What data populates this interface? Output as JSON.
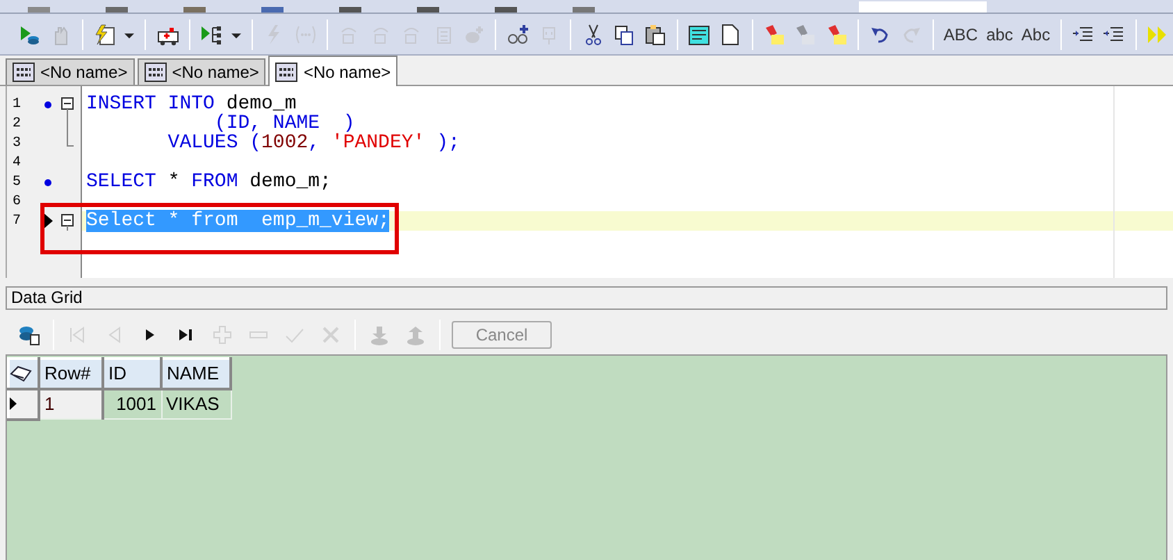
{
  "toolbar": {
    "items": [
      {
        "kind": "run",
        "disabled": false
      },
      {
        "kind": "hand",
        "disabled": true
      },
      {
        "kind": "sep"
      },
      {
        "kind": "script",
        "disabled": false
      },
      {
        "kind": "caret",
        "disabled": false
      },
      {
        "kind": "sep"
      },
      {
        "kind": "ambulance",
        "disabled": false
      },
      {
        "kind": "sep"
      },
      {
        "kind": "tree",
        "disabled": false
      },
      {
        "kind": "caret",
        "disabled": false
      },
      {
        "kind": "sep"
      },
      {
        "kind": "bolt",
        "disabled": true
      },
      {
        "kind": "dots",
        "disabled": true
      },
      {
        "kind": "sep"
      },
      {
        "kind": "step",
        "disabled": true
      },
      {
        "kind": "step",
        "disabled": true
      },
      {
        "kind": "step",
        "disabled": true
      },
      {
        "kind": "doc",
        "disabled": true
      },
      {
        "kind": "disc",
        "disabled": true
      },
      {
        "kind": "sep"
      },
      {
        "kind": "glasses",
        "disabled": false
      },
      {
        "kind": "plug",
        "disabled": true
      },
      {
        "kind": "sep"
      },
      {
        "kind": "cut",
        "disabled": false
      },
      {
        "kind": "copy",
        "disabled": false
      },
      {
        "kind": "paste",
        "disabled": false
      },
      {
        "kind": "sep"
      },
      {
        "kind": "note",
        "disabled": false
      },
      {
        "kind": "page",
        "disabled": false
      },
      {
        "kind": "sep"
      },
      {
        "kind": "marker",
        "disabled": false
      },
      {
        "kind": "marker",
        "disabled": true
      },
      {
        "kind": "marker",
        "disabled": false
      },
      {
        "kind": "sep"
      },
      {
        "kind": "undo",
        "disabled": false
      },
      {
        "kind": "redo",
        "disabled": true
      },
      {
        "kind": "sep"
      },
      {
        "kind": "text",
        "label": "ABC",
        "disabled": false
      },
      {
        "kind": "text",
        "label": "abc",
        "disabled": false
      },
      {
        "kind": "text",
        "label": "Abc",
        "disabled": false
      },
      {
        "kind": "sep"
      },
      {
        "kind": "indent",
        "disabled": false
      },
      {
        "kind": "outdent",
        "disabled": false
      },
      {
        "kind": "sep"
      },
      {
        "kind": "forward",
        "disabled": false
      }
    ]
  },
  "tabs": [
    {
      "label": "<No name>",
      "selected": false
    },
    {
      "label": "<No name>",
      "selected": false
    },
    {
      "label": "<No name>",
      "selected": true
    }
  ],
  "editor": {
    "highlight_box": true,
    "lines": [
      {
        "number": "1",
        "marker": true,
        "kind": "open",
        "current": false,
        "selected": false,
        "tokens": [
          {
            "text": "INSERT INTO ",
            "kind": "keyword"
          },
          {
            "text": "demo_m",
            "kind": "ident"
          }
        ]
      },
      {
        "number": "2",
        "marker": false,
        "kind": "body",
        "current": false,
        "selected": false,
        "tokens": [
          {
            "text": "           (ID, NAME  )",
            "kind": "keyword"
          }
        ]
      },
      {
        "number": "3",
        "marker": false,
        "kind": "end",
        "current": false,
        "selected": false,
        "tokens": [
          {
            "text": "       VALUES (",
            "kind": "keyword"
          },
          {
            "text": "1002",
            "kind": "number"
          },
          {
            "text": ", ",
            "kind": "keyword"
          },
          {
            "text": "'PANDEY'",
            "kind": "string"
          },
          {
            "text": " );",
            "kind": "keyword"
          }
        ]
      },
      {
        "number": "4",
        "marker": false,
        "kind": "plain",
        "current": false,
        "selected": false
      },
      {
        "number": "5",
        "marker": true,
        "kind": "plain",
        "current": false,
        "selected": false,
        "tokens": [
          {
            "text": "SELECT ",
            "kind": "keyword"
          },
          {
            "text": "* ",
            "kind": "ident"
          },
          {
            "text": "FROM ",
            "kind": "keyword"
          },
          {
            "text": "demo_m;",
            "kind": "ident"
          }
        ]
      },
      {
        "number": "6",
        "marker": false,
        "kind": "plain",
        "current": false,
        "selected": false
      },
      {
        "number": "7",
        "marker": false,
        "kind": "open",
        "current": true,
        "selected": true,
        "tokens": [
          {
            "text": "Select * from  emp_m_view;"
          }
        ]
      }
    ]
  },
  "grid": {
    "title": "Data Grid",
    "toolbar": [
      {
        "kind": "db",
        "disabled": false
      },
      {
        "kind": "sep"
      },
      {
        "kind": "first",
        "disabled": true
      },
      {
        "kind": "prev",
        "disabled": true
      },
      {
        "kind": "next",
        "disabled": false
      },
      {
        "kind": "last",
        "disabled": false
      },
      {
        "kind": "insert",
        "disabled": true
      },
      {
        "kind": "delete",
        "disabled": true
      },
      {
        "kind": "post",
        "disabled": true
      },
      {
        "kind": "cancelx",
        "disabled": true
      },
      {
        "kind": "sep"
      },
      {
        "kind": "download",
        "disabled": true
      },
      {
        "kind": "upload",
        "disabled": true
      },
      {
        "kind": "sep"
      },
      {
        "kind": "button",
        "label": "Cancel",
        "disabled": true
      }
    ],
    "columns": [
      "Row#",
      "ID",
      "NAME"
    ],
    "rows": [
      {
        "cells": [
          "1",
          "1001",
          "VIKAS"
        ],
        "current": true
      }
    ]
  }
}
